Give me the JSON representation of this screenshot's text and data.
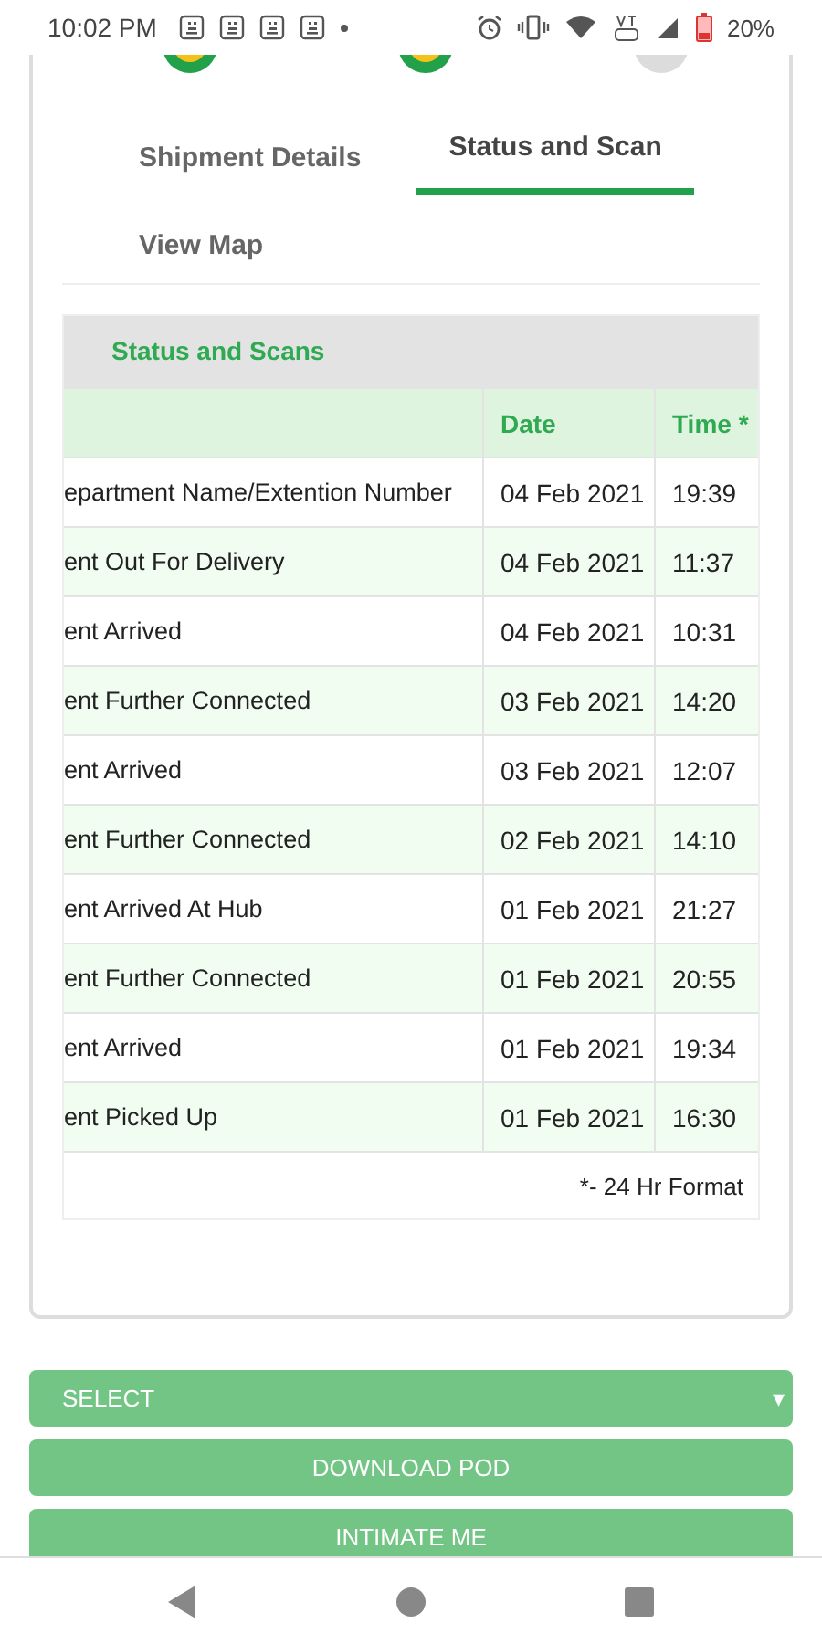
{
  "status_bar": {
    "time": "10:02 PM",
    "battery": "20%"
  },
  "steps": [
    {
      "done": true
    },
    {
      "done": true
    },
    {
      "done": false
    }
  ],
  "tabs": [
    {
      "label": "Shipment Details",
      "selected": false
    },
    {
      "label": "Status and Scan",
      "selected": true
    },
    {
      "label": "View Map",
      "selected": false
    }
  ],
  "scans": {
    "title": "Status and Scans",
    "columns": [
      "",
      "Date",
      "Time *"
    ],
    "rows": [
      [
        "epartment Name/Extention Number",
        "04 Feb 2021",
        "19:39"
      ],
      [
        "ent Out For Delivery",
        "04 Feb 2021",
        "11:37"
      ],
      [
        "ent Arrived",
        "04 Feb 2021",
        "10:31"
      ],
      [
        "ent Further Connected",
        "03 Feb 2021",
        "14:20"
      ],
      [
        "ent Arrived",
        "03 Feb 2021",
        "12:07"
      ],
      [
        "ent Further Connected",
        "02 Feb 2021",
        "14:10"
      ],
      [
        "ent Arrived At Hub",
        "01 Feb 2021",
        "21:27"
      ],
      [
        "ent Further Connected",
        "01 Feb 2021",
        "20:55"
      ],
      [
        "ent Arrived",
        "01 Feb 2021",
        "19:34"
      ],
      [
        "ent Picked Up",
        "01 Feb 2021",
        "16:30"
      ]
    ],
    "footnote": "*- 24 Hr Format"
  },
  "select": {
    "value": "SELECT",
    "caret": "▾"
  },
  "buttons": [
    "DOWNLOAD POD",
    "INTIMATE ME"
  ]
}
